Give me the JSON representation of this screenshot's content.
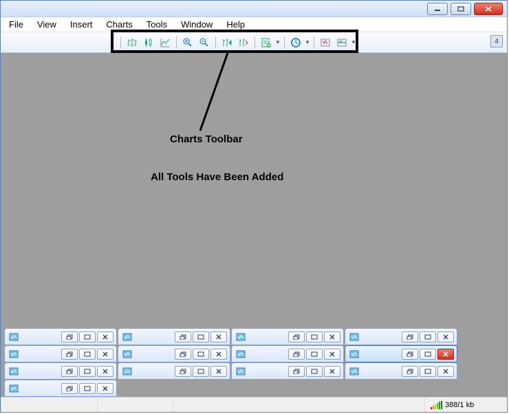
{
  "titlebar": {
    "min_label": "_",
    "max_label": "□",
    "close_label": "✕"
  },
  "menubar": {
    "items": [
      "File",
      "View",
      "Insert",
      "Charts",
      "Tools",
      "Window",
      "Help"
    ]
  },
  "charts_toolbar": {
    "buttons": [
      {
        "name": "bar-chart-icon"
      },
      {
        "name": "candlestick-icon"
      },
      {
        "name": "line-chart-icon"
      },
      {
        "sep": true
      },
      {
        "name": "zoom-in-icon"
      },
      {
        "name": "zoom-out-icon"
      },
      {
        "sep": true
      },
      {
        "name": "auto-scroll-icon"
      },
      {
        "name": "chart-shift-icon"
      },
      {
        "sep": true
      },
      {
        "name": "indicators-icon",
        "dd": true
      },
      {
        "sep": true
      },
      {
        "name": "periodicity-icon",
        "dd": true
      },
      {
        "sep": true
      },
      {
        "name": "templates-icon"
      },
      {
        "name": "shift-chart-icon",
        "dd": true
      }
    ]
  },
  "notification_count": "4",
  "annotation": {
    "line1": "Charts Toolbar",
    "line2": "All Tools Have Been Added"
  },
  "child_windows": {
    "rows": [
      {
        "cols": 1,
        "items": [
          {
            "active": false
          }
        ]
      },
      {
        "cols": 4,
        "items": [
          {
            "active": false
          },
          {
            "active": false
          },
          {
            "active": false
          },
          {
            "active": false
          }
        ]
      },
      {
        "cols": 4,
        "items": [
          {
            "active": false
          },
          {
            "active": false
          },
          {
            "active": false
          },
          {
            "active": true
          }
        ]
      },
      {
        "cols": 4,
        "items": [
          {
            "active": false
          },
          {
            "active": false
          },
          {
            "active": false
          },
          {
            "active": false
          }
        ]
      }
    ],
    "btn_restore": "❐",
    "btn_max": "□",
    "btn_close": "✕"
  },
  "statusbar": {
    "connection": "388/1 kb"
  }
}
